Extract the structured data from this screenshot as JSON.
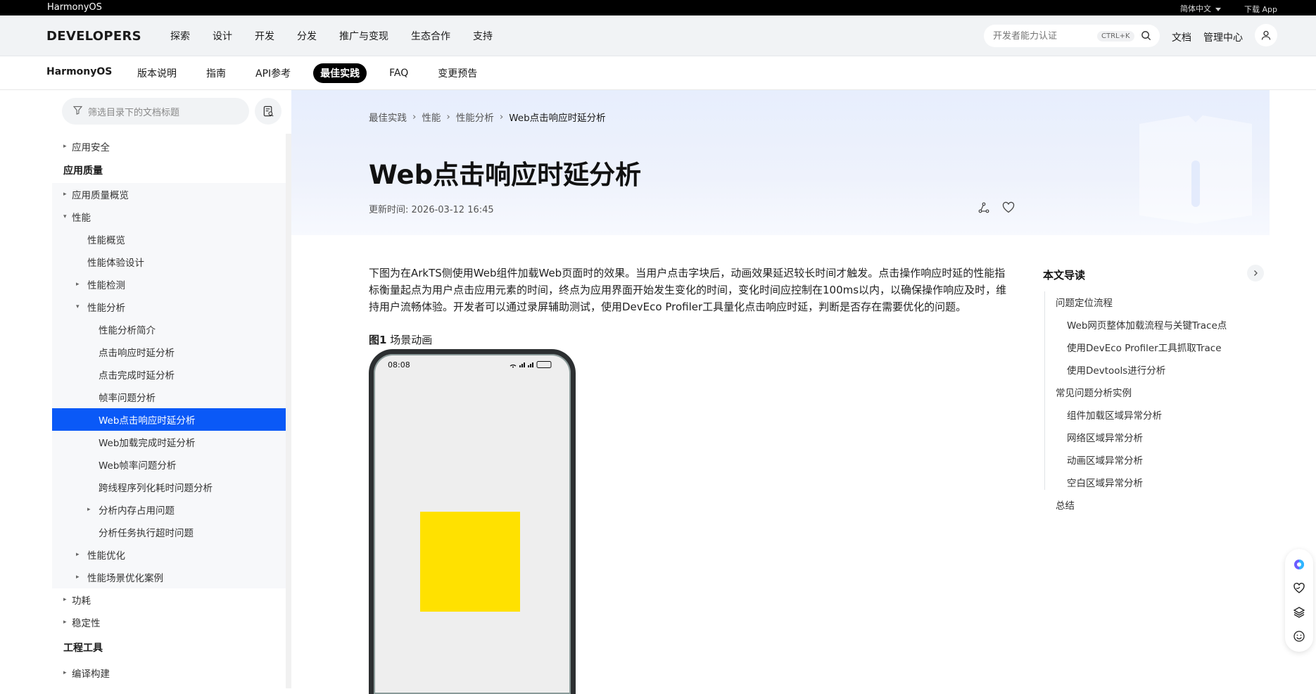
{
  "topbar": {
    "brand": "HarmonyOS",
    "lang": "简体中文",
    "download": "下载 App"
  },
  "header": {
    "logo": "DEVELOPERS",
    "nav": [
      "探索",
      "设计",
      "开发",
      "分发",
      "推广与变现",
      "生态合作",
      "支持"
    ],
    "search_placeholder": "开发者能力认证",
    "search_kbd": "CTRL+K",
    "docs": "文档",
    "admin": "管理中心"
  },
  "subnav": {
    "os": "HarmonyOS",
    "items": [
      "版本说明",
      "指南",
      "API参考",
      "最佳实践",
      "FAQ",
      "变更预告"
    ],
    "active": "最佳实践"
  },
  "sidebar": {
    "filter_placeholder": "筛选目录下的文档标题",
    "items": [
      {
        "label": "应用安全",
        "arrow": "▸"
      },
      {
        "label": "应用质量"
      },
      {
        "label": "应用质量概览",
        "arrow": "▸"
      },
      {
        "label": "性能",
        "arrow": "▾"
      },
      {
        "label": "性能概览"
      },
      {
        "label": "性能体验设计"
      },
      {
        "label": "性能检测",
        "arrow": "▸"
      },
      {
        "label": "性能分析",
        "arrow": "▾"
      },
      {
        "label": "性能分析简介"
      },
      {
        "label": "点击响应时延分析"
      },
      {
        "label": "点击完成时延分析"
      },
      {
        "label": "帧率问题分析"
      },
      {
        "label": "Web点击响应时延分析"
      },
      {
        "label": "Web加载完成时延分析"
      },
      {
        "label": "Web帧率问题分析"
      },
      {
        "label": "跨线程序列化耗时问题分析"
      },
      {
        "label": "分析内存占用问题",
        "arrow": "▸"
      },
      {
        "label": "分析任务执行超时问题"
      },
      {
        "label": "性能优化",
        "arrow": "▸"
      },
      {
        "label": "性能场景优化案例",
        "arrow": "▸"
      },
      {
        "label": "功耗",
        "arrow": "▸"
      },
      {
        "label": "稳定性",
        "arrow": "▸"
      },
      {
        "label": "工程工具"
      },
      {
        "label": "编译构建",
        "arrow": "▸"
      }
    ]
  },
  "article": {
    "breadcrumb": [
      "最佳实践",
      "性能",
      "性能分析",
      "Web点击响应时延分析"
    ],
    "title": "Web点击响应时延分析",
    "updated": "更新时间: 2026-03-12 16:45",
    "paragraph": "下图为在ArkTS侧使用Web组件加载Web页面时的效果。当用户点击字块后，动画效果延迟较长时间才触发。点击操作响应时延的性能指标衡量起点为用户点击应用元素的时间，终点为应用界面开始发生变化的时间，变化时间应控制在100ms以内，以确保操作响应及时，维持用户流畅体验。开发者可以通过录屏辅助测试，使用DevEco Profiler工具量化点击响应时延，判断是否存在需要优化的问题。",
    "fig_label": "图1",
    "fig_caption": "场景动画",
    "phone_time": "08:08",
    "phone_battery": "100"
  },
  "toc": {
    "head": "本文导读",
    "items": [
      "问题定位流程",
      "Web网页整体加载流程与关键Trace点",
      "使用DevEco Profiler工具抓取Trace",
      "使用Devtools进行分析",
      "常见问题分析实例",
      "组件加载区域异常分析",
      "网络区域异常分析",
      "动画区域异常分析",
      "空白区域异常分析",
      "总结"
    ]
  },
  "colors": {
    "accent": "#0a59f7",
    "highlight_box": "#ffe100"
  }
}
